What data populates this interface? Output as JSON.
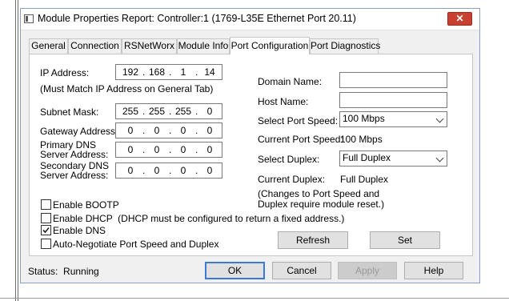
{
  "window": {
    "title": "Module Properties Report: Controller:1 (1769-L35E Ethernet Port 20.11)",
    "close_glyph": "✕"
  },
  "tabs": [
    {
      "label": "General"
    },
    {
      "label": "Connection"
    },
    {
      "label": "RSNetWorx"
    },
    {
      "label": "Module Info"
    },
    {
      "label": "Port Configuration",
      "active": true
    },
    {
      "label": "Port Diagnostics"
    }
  ],
  "left": {
    "ip_label": "IP Address:",
    "ip": [
      "192",
      "168",
      "1",
      "14"
    ],
    "ip_note": "(Must Match IP Address on General Tab)",
    "subnet_label": "Subnet Mask:",
    "subnet": [
      "255",
      "255",
      "255",
      "0"
    ],
    "gateway_label": "Gateway Address:",
    "gateway": [
      "0",
      "0",
      "0",
      "0"
    ],
    "primary_dns_label_1": "Primary DNS",
    "primary_dns_label_2": "Server Address:",
    "primary_dns": [
      "0",
      "0",
      "0",
      "0"
    ],
    "secondary_dns_label_1": "Secondary DNS",
    "secondary_dns_label_2": "Server Address:",
    "secondary_dns": [
      "0",
      "0",
      "0",
      "0"
    ],
    "dot": "."
  },
  "right": {
    "domain_label": "Domain Name:",
    "domain_value": "",
    "host_label": "Host Name:",
    "host_value": "",
    "select_speed_label": "Select Port Speed:",
    "select_speed_value": "100 Mbps",
    "current_speed_label": "Current Port Speed:",
    "current_speed_value": "100 Mbps",
    "select_duplex_label": "Select Duplex:",
    "select_duplex_value": "Full Duplex",
    "current_duplex_label": "Current Duplex:",
    "current_duplex_value": "Full Duplex",
    "note_1": "(Changes to Port Speed and",
    "note_2": "Duplex require module reset.)"
  },
  "checkboxes": {
    "bootp": {
      "label": "Enable BOOTP",
      "checked": false
    },
    "dhcp": {
      "label": "Enable DHCP  (DHCP must be configured to return a fixed address.)",
      "checked": false
    },
    "dns": {
      "label": "Enable DNS",
      "checked": true
    },
    "autoneg": {
      "label": "Auto-Negotiate Port Speed and Duplex",
      "checked": false
    }
  },
  "panel_buttons": {
    "refresh": "Refresh",
    "set": "Set"
  },
  "footer": {
    "status": "Status:  Running",
    "ok": "OK",
    "cancel": "Cancel",
    "apply": "Apply",
    "help": "Help"
  },
  "colors": {
    "accent": "#3b7ad1",
    "close": "#c84031"
  }
}
